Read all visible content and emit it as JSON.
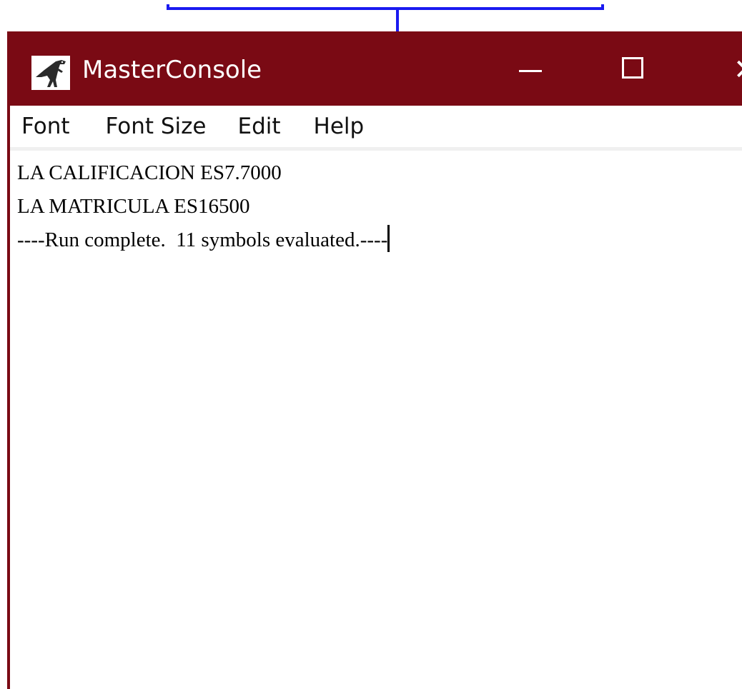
{
  "window": {
    "title": "MasterConsole",
    "app_icon": "trex-icon",
    "controls": {
      "minimize_icon": "minimize-icon",
      "maximize_icon": "maximize-icon",
      "close_icon": "close-icon",
      "close_glyph": "✕"
    },
    "title_bar_color": "#7a0a14"
  },
  "menu": {
    "items": [
      {
        "label": "Font"
      },
      {
        "label": "Font Size"
      },
      {
        "label": "Edit"
      },
      {
        "label": "Help"
      }
    ]
  },
  "console": {
    "lines": [
      "LA CALIFICACION ES7.7000",
      "LA MATRICULA ES16500",
      "----Run complete.  11 symbols evaluated.----"
    ]
  },
  "background": {
    "connector_color": "#1a1af0"
  }
}
